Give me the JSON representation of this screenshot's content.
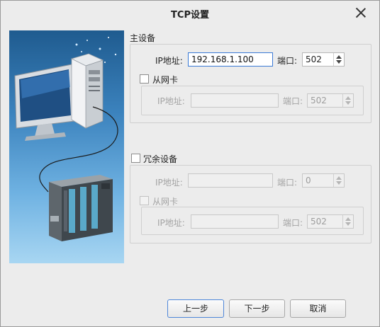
{
  "window": {
    "title": "TCP设置"
  },
  "primary": {
    "group_label": "主设备",
    "ip_label": "IP地址:",
    "ip_value": "192.168.1.100",
    "port_label": "端口:",
    "port_value": "502",
    "secondary_nic": {
      "checkbox_label": "从网卡",
      "checked": false,
      "ip_label": "IP地址:",
      "ip_value": "",
      "port_label": "端口:",
      "port_value": "502"
    }
  },
  "redundant": {
    "checkbox_label": "冗余设备",
    "checked": false,
    "ip_label": "IP地址:",
    "ip_value": "",
    "port_label": "端口:",
    "port_value": "0",
    "secondary_nic": {
      "checkbox_label": "从网卡",
      "checked": false,
      "ip_label": "IP地址:",
      "ip_value": "",
      "port_label": "端口:",
      "port_value": "502"
    }
  },
  "buttons": {
    "prev": "上一步",
    "next": "下一步",
    "cancel": "取消"
  },
  "illustration": {
    "icons": [
      "desktop-computer-icon",
      "plc-device-icon"
    ]
  }
}
